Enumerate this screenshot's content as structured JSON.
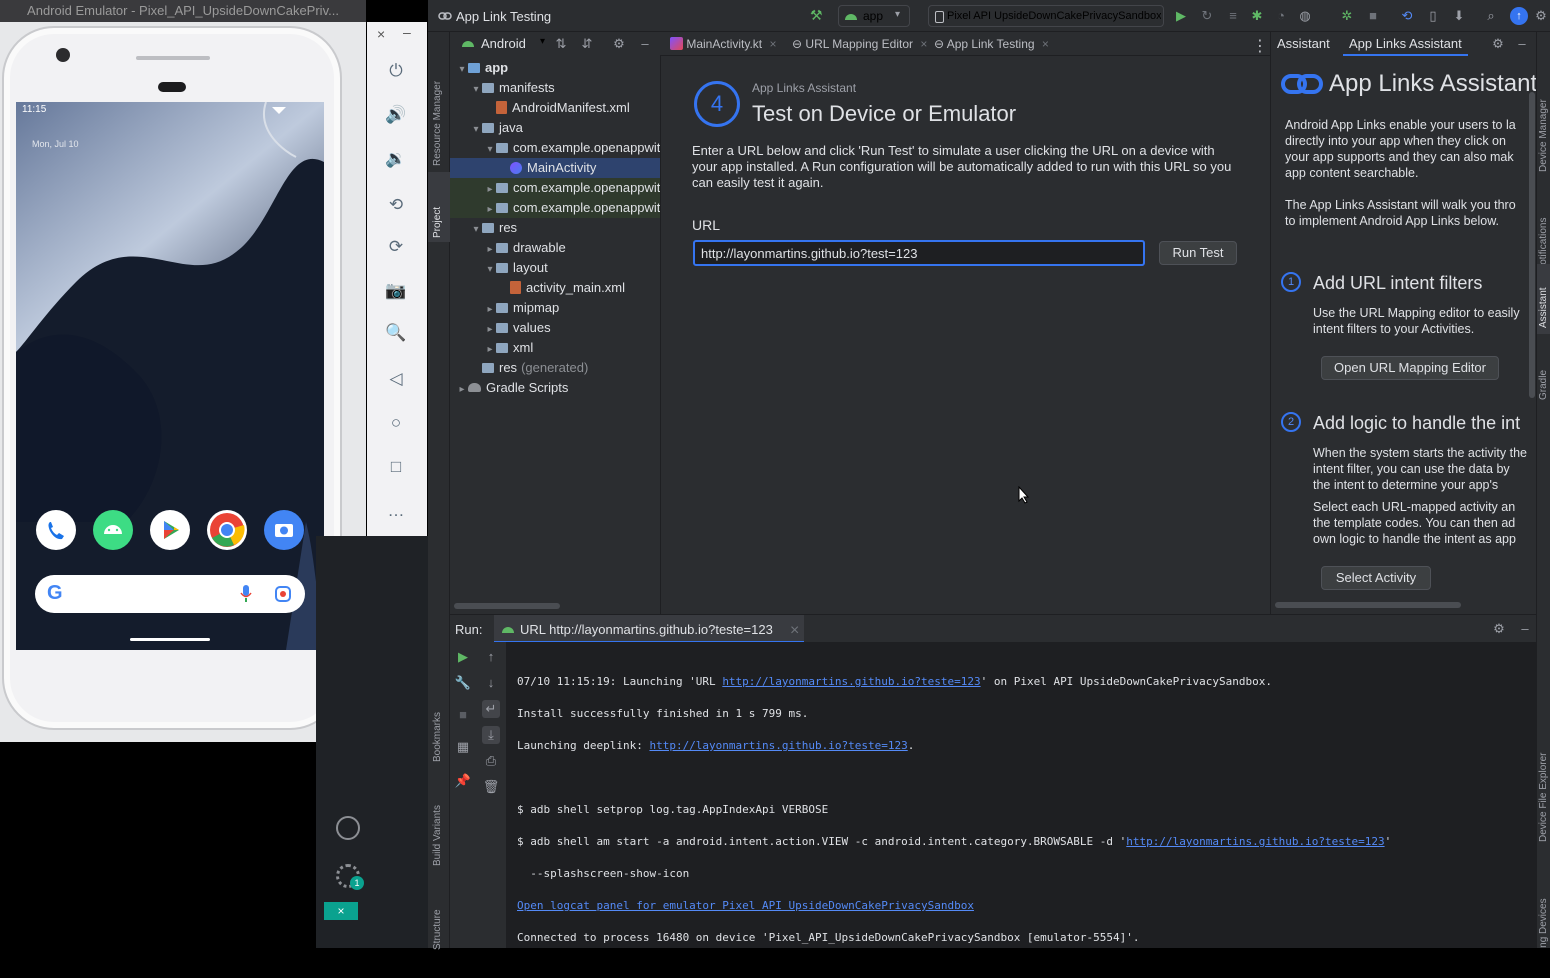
{
  "emulator": {
    "window_title": "Android Emulator - Pixel_API_UpsideDownCakePriv...",
    "status_time": "11:15",
    "date_text": "Mon, Jul 10",
    "side_icons": [
      "power-icon",
      "volume-up-icon",
      "volume-down-icon",
      "rotate-left-icon",
      "rotate-right-icon",
      "camera-icon",
      "zoom-icon",
      "back-icon",
      "home-icon",
      "overview-icon",
      "more-icon"
    ],
    "close_glyph": "×",
    "minimize_glyph": "–"
  },
  "ide": {
    "window_title": "App Link Testing",
    "run_config": "app",
    "device": "Pixel API UpsideDownCakePrivacySandbox",
    "project_view": "Android",
    "editor_tabs": [
      {
        "label": "MainActivity.kt"
      },
      {
        "label": "URL Mapping Editor"
      },
      {
        "label": "App Link Testing"
      }
    ],
    "left_stripe": {
      "resource_manager": "Resource Manager",
      "project": "Project",
      "bookmarks": "Bookmarks",
      "build_variants": "Build Variants",
      "structure": "Structure"
    },
    "right_stripe": {
      "device_manager": "Device Manager",
      "notifications": "Notifications",
      "assistant": "Assistant",
      "gradle": "Gradle",
      "device_file_explorer": "Device File Explorer",
      "running_devices": "Running Devices"
    },
    "tree": [
      {
        "label": "app",
        "bold": true,
        "indent": 0,
        "chev": "▾",
        "kind": "module"
      },
      {
        "label": "manifests",
        "indent": 1,
        "chev": "▾",
        "kind": "folder"
      },
      {
        "label": "AndroidManifest.xml",
        "indent": 2,
        "chev": "",
        "kind": "xml"
      },
      {
        "label": "java",
        "indent": 1,
        "chev": "▾",
        "kind": "folder"
      },
      {
        "label": "com.example.openappwith",
        "indent": 2,
        "chev": "▾",
        "kind": "folder"
      },
      {
        "label": "MainActivity",
        "indent": 3,
        "chev": "",
        "kind": "kotlin",
        "selected": true
      },
      {
        "label": "com.example.openappwith",
        "indent": 2,
        "chev": "▸",
        "kind": "folder",
        "green": true
      },
      {
        "label": "com.example.openappwith",
        "indent": 2,
        "chev": "▸",
        "kind": "folder",
        "green": true
      },
      {
        "label": "res",
        "indent": 1,
        "chev": "▾",
        "kind": "folder"
      },
      {
        "label": "drawable",
        "indent": 2,
        "chev": "▸",
        "kind": "folder"
      },
      {
        "label": "layout",
        "indent": 2,
        "chev": "▾",
        "kind": "folder"
      },
      {
        "label": "activity_main.xml",
        "indent": 3,
        "chev": "",
        "kind": "xml"
      },
      {
        "label": "mipmap",
        "indent": 2,
        "chev": "▸",
        "kind": "folder"
      },
      {
        "label": "values",
        "indent": 2,
        "chev": "▸",
        "kind": "folder"
      },
      {
        "label": "xml",
        "indent": 2,
        "chev": "▸",
        "kind": "folder"
      },
      {
        "label": "res",
        "suffix": "(generated)",
        "indent": 1,
        "chev": "",
        "kind": "folder"
      },
      {
        "label": "Gradle Scripts",
        "indent": 0,
        "chev": "▸",
        "kind": "gradle"
      }
    ],
    "editor": {
      "step_number": "4",
      "overline": "App Links Assistant",
      "heading": "Test on Device or Emulator",
      "description": "Enter a URL below and click 'Run Test' to simulate a user clicking the URL on a device with your app installed. A Run configuration will be automatically added to run with this URL so you can easily test it again.",
      "url_label": "URL",
      "url_value": "http://layonmartins.github.io?test=123",
      "run_button": "Run Test"
    },
    "assistant": {
      "tab_assistant": "Assistant",
      "tab_app_links": "App Links Assistant",
      "title": "App Links Assistant",
      "intro1": "Android App Links enable your users to la directly into your app when they click on your app supports and they can also mak app content searchable.",
      "intro2": "The App Links Assistant will walk you thro to implement Android App Links below.",
      "step1_num": "1",
      "step1_title": "Add URL intent filters",
      "step1_text": "Use the URL Mapping editor to easily intent filters to your Activities.",
      "step1_button": "Open URL Mapping Editor",
      "step2_num": "2",
      "step2_title": "Add logic to handle the int",
      "step2_text1": "When the system starts the activity the intent filter, you can use the data by the intent to determine your app's",
      "step2_text2": "Select each URL-mapped activity an the template codes. You can then ad own logic to handle the intent as app",
      "step2_button": "Select Activity"
    },
    "run_panel": {
      "label": "Run:",
      "tab": "URL http://layonmartins.github.io?teste=123",
      "line1_pre": "07/10 11:15:19: Launching 'URL ",
      "line1_link": "http://layonmartins.github.io?teste=123",
      "line1_post": "' on Pixel API UpsideDownCakePrivacySandbox.",
      "line2": "Install successfully finished in 1 s 799 ms.",
      "line3_pre": "Launching deeplink: ",
      "line3_link": "http://layonmartins.github.io?teste=123",
      "line3_post": ".",
      "line4": "$ adb shell setprop log.tag.AppIndexApi VERBOSE",
      "line5_pre": "$ adb shell am start -a android.intent.action.VIEW -c android.intent.category.BROWSABLE -d '",
      "line5_link": "http://layonmartins.github.io?teste=123",
      "line5_post": "'",
      "line6": "  --splashscreen-show-icon",
      "line7_link": "Open logcat panel for emulator Pixel API UpsideDownCakePrivacySandbox",
      "line8": "Connected to process 16480 on device 'Pixel_API_UpsideDownCakePrivacySandbox [emulator-5554]'."
    },
    "settings_badge": "1"
  },
  "colors": {
    "accent": "#3574f0",
    "link": "#548af7",
    "ide_bg": "#2b2d30",
    "editor_bg": "#1e1f22",
    "run_green": "#5fb865"
  }
}
